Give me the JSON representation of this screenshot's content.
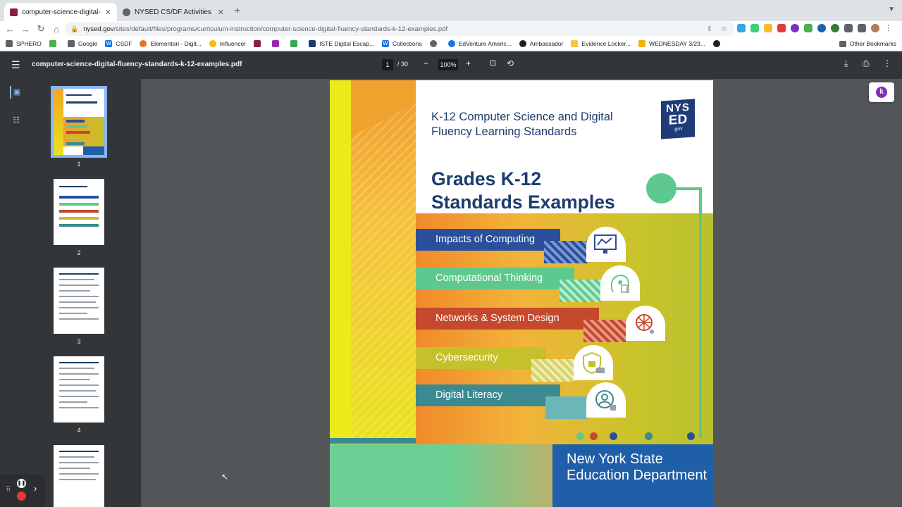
{
  "browser": {
    "tabs": [
      {
        "title": "computer-science-digital-fluen",
        "active": true
      },
      {
        "title": "NYSED CS/DF Activities and Ex",
        "active": false
      }
    ],
    "url_host": "nysed.gov",
    "url_path": "/sites/default/files/programs/curriculum-instruction/computer-science-digital-fluency-standards-k-12-examples.pdf"
  },
  "bookmarks": [
    "SPHERO",
    "Google",
    "CSDF",
    "Elementari - Digit...",
    "Influencer",
    "ISTE Digital Escap...",
    "Collections",
    "EdVenture Americ...",
    "Ambassador",
    "Evidence Locker...",
    "WEDNESDAY 3/29..."
  ],
  "bookmarks_other": "Other Bookmarks",
  "pdf": {
    "filename": "computer-science-digital-fluency-standards-k-12-examples.pdf",
    "page": "1",
    "total": "/ 30",
    "zoom": "100%"
  },
  "thumbnails": [
    "1",
    "2",
    "3",
    "4"
  ],
  "document": {
    "header_line": "K-12 Computer Science and Digital Fluency Learning Standards",
    "logo_top": "NYS",
    "logo_mid": "ED",
    "logo_bottom": ".gov",
    "title_line1": "Grades K-12",
    "title_line2": "Standards Examples",
    "bands": [
      {
        "label": "Impacts of Computing",
        "color": "#2b4f9a"
      },
      {
        "label": "Computational Thinking",
        "color": "#5ec98e"
      },
      {
        "label": "Networks & System Design",
        "color": "#c5492c"
      },
      {
        "label": "Cybersecurity",
        "color": "#c4c12a"
      },
      {
        "label": "Digital Literacy",
        "color": "#3b8a91"
      }
    ],
    "footer": "New York State Education Department"
  }
}
